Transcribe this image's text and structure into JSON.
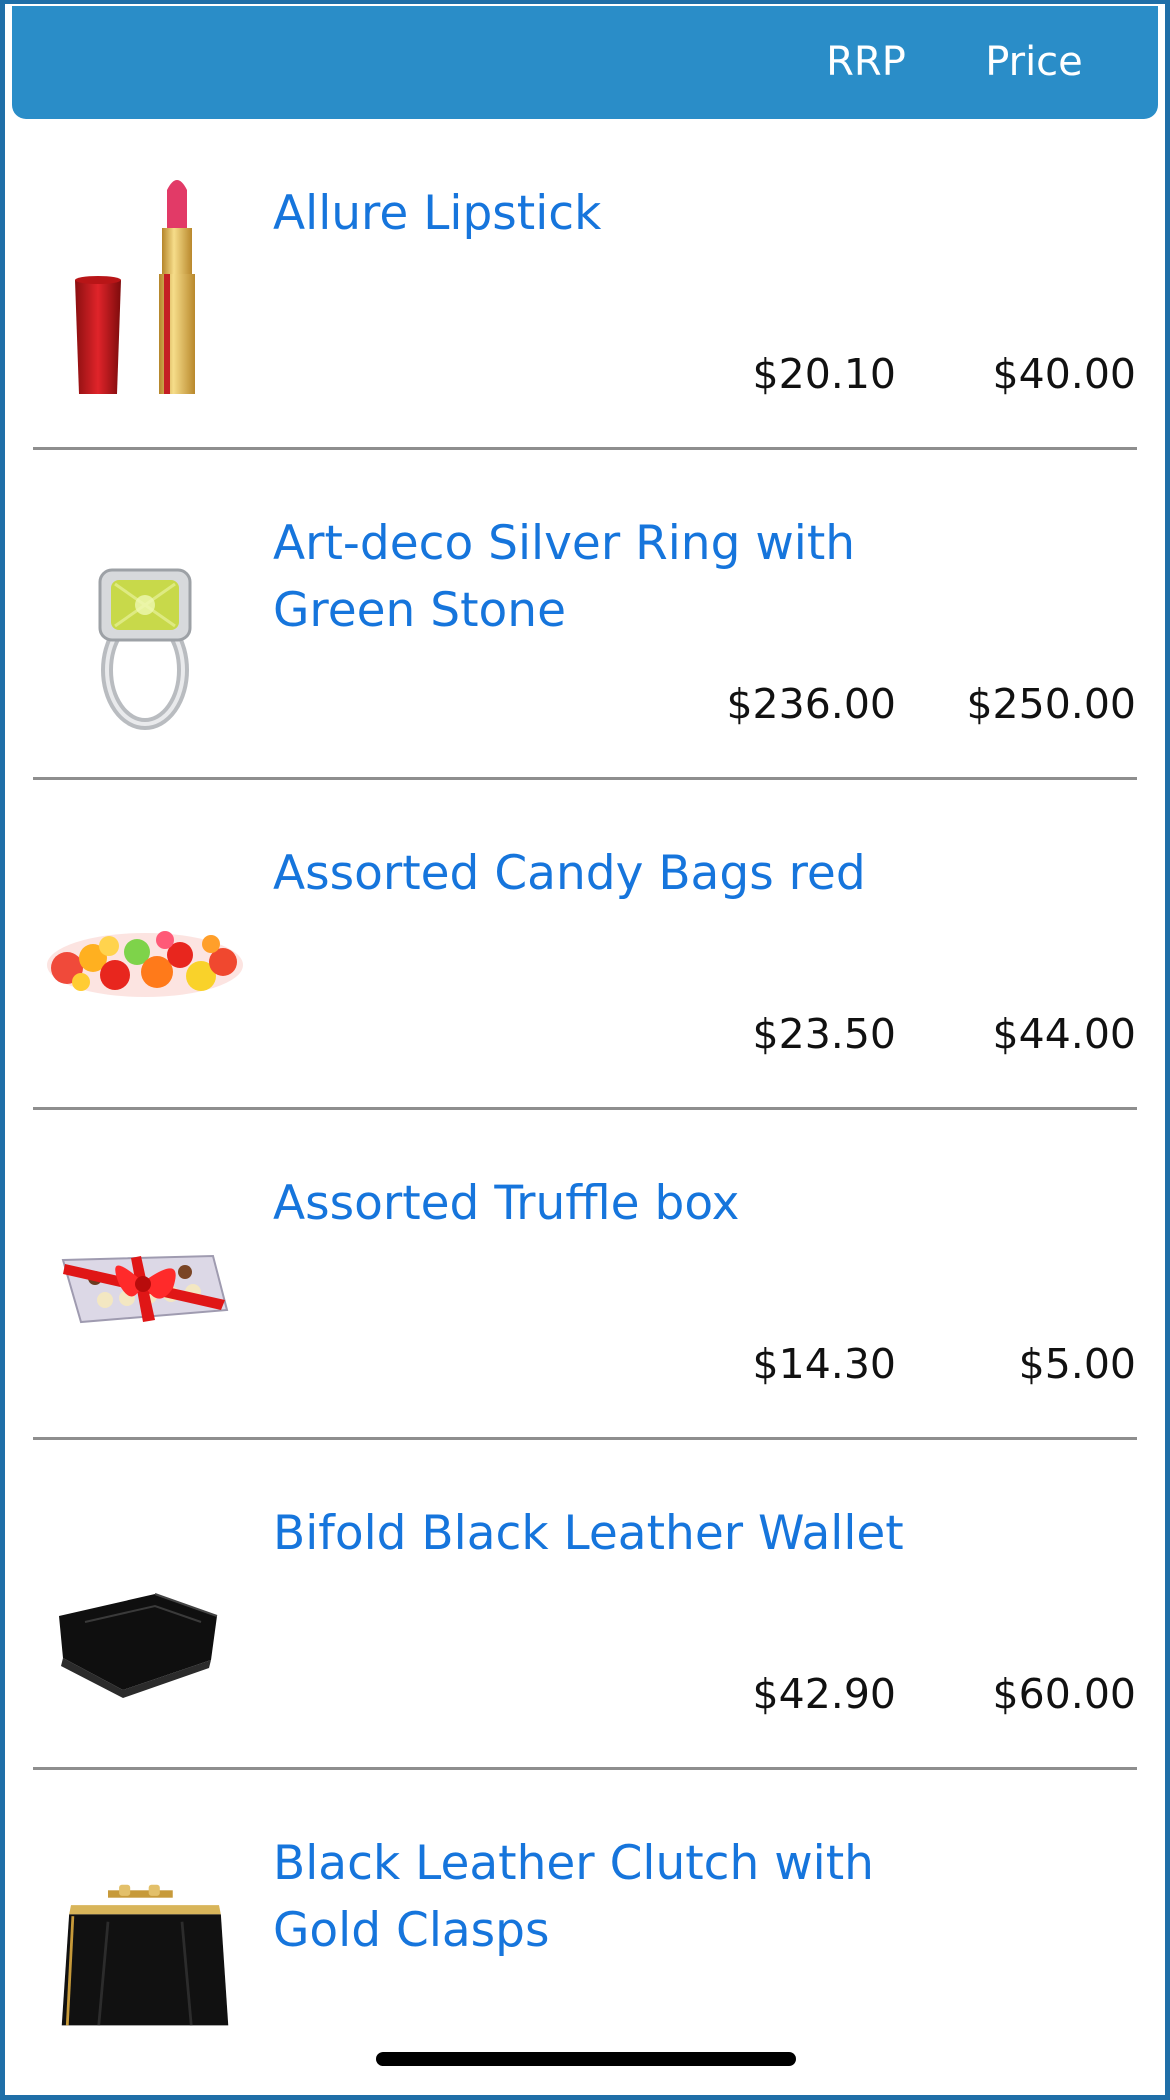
{
  "header": {
    "rrp_label": "RRP",
    "price_label": "Price"
  },
  "items": [
    {
      "name": "Allure Lipstick",
      "rrp": "$20.10",
      "price": "$40.00",
      "image": "lipstick-image"
    },
    {
      "name": "Art-deco Silver Ring with Green Stone",
      "rrp": "$236.00",
      "price": "$250.00",
      "image": "silver-ring-image"
    },
    {
      "name": "Assorted Candy Bags red",
      "rrp": "$23.50",
      "price": "$44.00",
      "image": "candy-image"
    },
    {
      "name": "Assorted Truffle box",
      "rrp": "$14.30",
      "price": "$5.00",
      "image": "truffle-box-image"
    },
    {
      "name": "Bifold Black Leather Wallet",
      "rrp": "$42.90",
      "price": "$60.00",
      "image": "wallet-image"
    },
    {
      "name": "Black Leather Clutch with Gold Clasps",
      "image": "clutch-image"
    }
  ],
  "colors": {
    "header": "#2a8dc8",
    "frame": "#1f6fa8",
    "product_name": "#1675dc",
    "price_text": "#111111"
  }
}
